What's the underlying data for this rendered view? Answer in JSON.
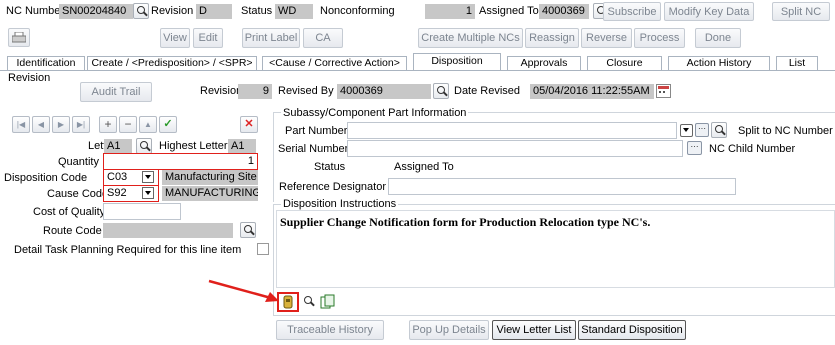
{
  "header": {
    "nc_number_label": "NC Number",
    "nc_number": "SN00204840",
    "revision_label": "Revision",
    "revision": "D",
    "status_label": "Status",
    "status": "WD",
    "status_desc": "Nonconforming",
    "count": "1",
    "assigned_to_label": "Assigned To",
    "assigned_to": "4000369",
    "subscribe": "Subscribe",
    "modify_key_data": "Modify Key Data",
    "split_nc": "Split NC"
  },
  "toolbar": {
    "view": "View",
    "edit": "Edit",
    "print_label": "Print Label",
    "ca": "CA",
    "create_multiple": "Create Multiple NCs",
    "reassign": "Reassign",
    "reverse": "Reverse",
    "process": "Process",
    "done": "Done"
  },
  "tabs": [
    "Identification",
    "Create / <Predisposition> / <SPR>",
    "<Cause / Corrective Action>",
    "Disposition",
    "Approvals",
    "Closure",
    "Action History",
    "List"
  ],
  "revision_row": {
    "section_label": "Revision",
    "audit_trail": "Audit Trail",
    "revision_label": "Revision",
    "revision_value": "9",
    "revised_by_label": "Revised By",
    "revised_by": "4000369",
    "date_revised_label": "Date Revised",
    "date_revised": "05/04/2016 11:22:55AM"
  },
  "left": {
    "letter_label": "Letter",
    "letter": "A1",
    "highest_letter_label": "Highest Letter",
    "highest_letter": "A1",
    "quantity_label": "Quantity",
    "quantity": "1",
    "disposition_code_label": "Disposition Code",
    "disposition_code": "C03",
    "disposition_desc": "Manufacturing Site",
    "cause_code_label": "Cause Code",
    "cause_code": "S92",
    "cause_desc": "MANUFACTURING",
    "cost_label": "Cost of Quality",
    "route_code_label": "Route Code",
    "detail_task_label": "Detail Task Planning Required for this line item"
  },
  "subassy": {
    "legend": "Subassy/Component Part Information",
    "part_number_label": "Part Number",
    "serial_number_label": "Serial Number",
    "status_label": "Status",
    "assigned_to_label": "Assigned To",
    "ref_designator_label": "Reference Designator",
    "split_label": "Split to NC Number",
    "child_label": "NC Child Number"
  },
  "disposition_instructions": {
    "legend": "Disposition Instructions",
    "text": "Supplier Change Notification form for Production Relocation type NC's."
  },
  "bottom_buttons": {
    "traceable_history": "Traceable History",
    "pop_up_details": "Pop Up Details",
    "view_letter_list": "View Letter List",
    "standard_disposition": "Standard Disposition"
  },
  "colors": {
    "highlight_gray": "#c7c7c7",
    "annotation_red": "#e0201b",
    "tab_panel_border": "#aab4c0"
  }
}
